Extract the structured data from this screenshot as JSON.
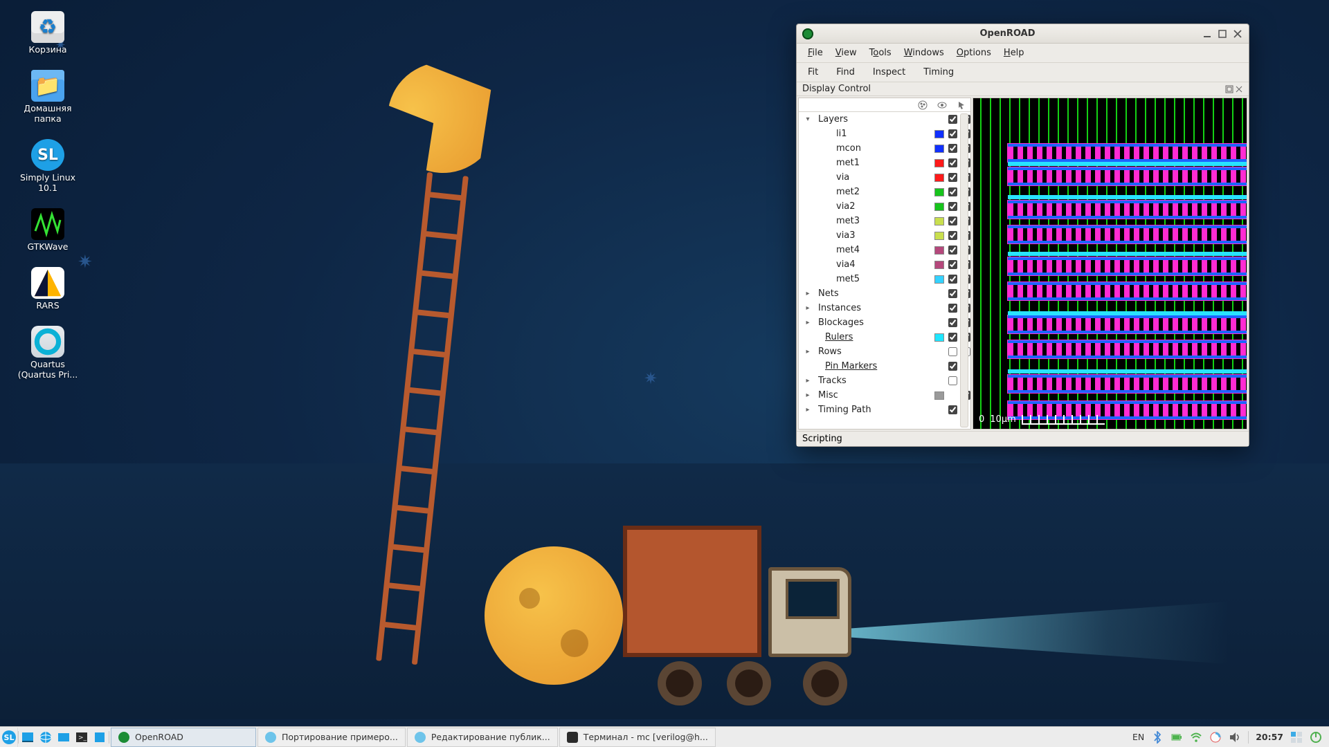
{
  "desktop_icons": [
    {
      "name": "trash",
      "label": "Корзина"
    },
    {
      "name": "home",
      "label": "Домашняя папка"
    },
    {
      "name": "simply",
      "label": "Simply Linux 10.1"
    },
    {
      "name": "gtkwave",
      "label": "GTKWave"
    },
    {
      "name": "rars",
      "label": "RARS"
    },
    {
      "name": "quartus",
      "label": "Quartus (Quartus Pri..."
    }
  ],
  "openroad": {
    "title": "OpenROAD",
    "menu_file": "File",
    "menu_view": "View",
    "menu_tools": "Tools",
    "menu_windows": "Windows",
    "menu_options": "Options",
    "menu_help": "Help",
    "tool_fit": "Fit",
    "tool_find": "Find",
    "tool_inspect": "Inspect",
    "tool_timing": "Timing",
    "panel_display_control": "Display Control",
    "panel_scripting": "Scripting",
    "ruler_zero": "0",
    "ruler_scale": "10µm",
    "dc": {
      "groups": {
        "layers": "Layers",
        "nets": "Nets",
        "instances": "Instances",
        "blockages": "Blockages",
        "rulers": "Rulers",
        "rows": "Rows",
        "pins": "Pin Markers",
        "tracks": "Tracks",
        "misc": "Misc",
        "timing": "Timing Path"
      },
      "layers": [
        {
          "name": "li1",
          "color": "#1030ff"
        },
        {
          "name": "mcon",
          "color": "#1030ff"
        },
        {
          "name": "met1",
          "color": "#ff1a1a"
        },
        {
          "name": "via",
          "color": "#ff1a1a"
        },
        {
          "name": "met2",
          "color": "#17c41c"
        },
        {
          "name": "via2",
          "color": "#17c41c"
        },
        {
          "name": "met3",
          "color": "#c9df4e"
        },
        {
          "name": "via3",
          "color": "#c9df4e"
        },
        {
          "name": "met4",
          "color": "#b5487c"
        },
        {
          "name": "via4",
          "color": "#b5487c"
        },
        {
          "name": "met5",
          "color": "#34d2ff"
        }
      ],
      "rulers_color": "#1fe6ff",
      "misc_swatch": "#9a9a9a"
    }
  },
  "taskbar": {
    "btn_openroad": "OpenROAD",
    "btn_browser1": "Портирование примеро...",
    "btn_browser2": "Редактирование публик...",
    "btn_terminal": "Терминал - mc [verilog@h...",
    "lang": "EN",
    "clock": "20:57"
  },
  "colors": {
    "window_bg": "#edebe7",
    "accent_blue": "#1ea0e6"
  }
}
